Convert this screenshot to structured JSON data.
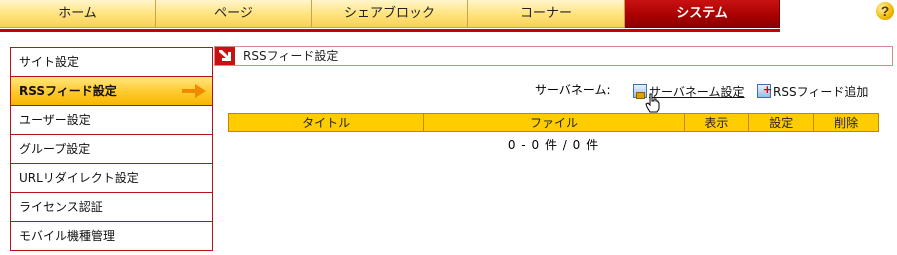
{
  "topnav": {
    "tabs": [
      {
        "label": "ホーム"
      },
      {
        "label": "ページ"
      },
      {
        "label": "シェアブロック"
      },
      {
        "label": "コーナー"
      },
      {
        "label": "システム"
      }
    ],
    "active_tab": "システム",
    "help_icon": "question-circle-icon"
  },
  "sidebar": {
    "items": [
      {
        "label": "サイト設定"
      },
      {
        "label": "RSSフィード設定"
      },
      {
        "label": "ユーザー設定"
      },
      {
        "label": "グループ設定"
      },
      {
        "label": "URLリダイレクト設定"
      },
      {
        "label": "ライセンス認証"
      },
      {
        "label": "モバイル機種管理"
      }
    ],
    "active_item": "RSSフィード設定",
    "active_arrow_icon": "right-arrow-icon"
  },
  "content": {
    "header_title": "RSSフィード設定",
    "header_icon": "red-down-arrow-icon",
    "server_name_label": "サーバネーム:",
    "server_name_value": "",
    "links": {
      "server_name_setting": "サーバネーム設定",
      "add_rss_feed": "RSSフィード追加"
    },
    "table": {
      "columns": [
        "タイトル",
        "ファイル",
        "表示",
        "設定",
        "削除"
      ]
    },
    "pager_text": "0 - 0 件 / 0 件"
  },
  "colors": {
    "active_tab_bg": "#b00000",
    "tab_bg": "#ffe27a",
    "sidebar_border": "#b5121b",
    "table_header_bg": "#ffcc00"
  }
}
